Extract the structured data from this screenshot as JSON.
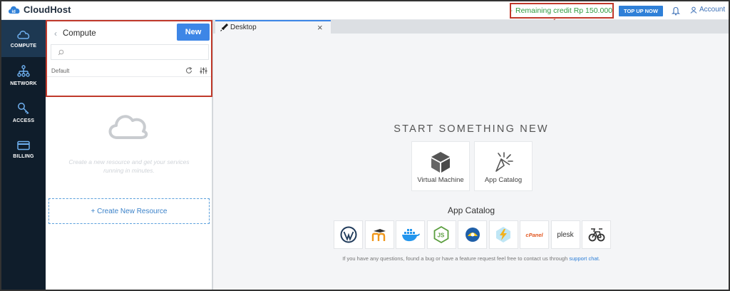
{
  "header": {
    "logo_badge": "id",
    "logo_text": "CloudHost",
    "credit_text": "Remaining credit Rp 150.000",
    "topup_label": "TOP UP NOW",
    "account_label": "Account",
    "credit_color": "#2e9b3e",
    "accent": "#2f80d8"
  },
  "sidebar": {
    "items": [
      {
        "label": "COMPUTE",
        "icon": "cloud-icon",
        "active": true
      },
      {
        "label": "NETWORK",
        "icon": "network-icon",
        "active": false
      },
      {
        "label": "ACCESS",
        "icon": "key-icon",
        "active": false
      },
      {
        "label": "BILLING",
        "icon": "card-icon",
        "active": false
      }
    ]
  },
  "compute_panel": {
    "title": "Compute",
    "new_label": "New",
    "search_placeholder": "",
    "group_label": "Default",
    "empty_message": "Create a new resource and get your services running in minutes.",
    "create_label": "+ Create New Resource"
  },
  "desktop": {
    "tab_label": "Desktop",
    "headline": "START SOMETHING NEW",
    "cards": [
      {
        "label": "Virtual Machine",
        "icon": "cube-icon"
      },
      {
        "label": "App Catalog",
        "icon": "cursor-click-icon"
      }
    ],
    "catalog_title": "App Catalog",
    "apps": [
      {
        "name": "wordpress-icon"
      },
      {
        "name": "moodle-icon"
      },
      {
        "name": "docker-icon"
      },
      {
        "name": "nodejs-icon"
      },
      {
        "name": "tutwuri-icon"
      },
      {
        "name": "lightning-app-icon"
      },
      {
        "name": "cpanel-icon",
        "text": "cPanel"
      },
      {
        "name": "plesk-icon",
        "text": "plesk"
      },
      {
        "name": "bike-app-icon"
      }
    ],
    "footer_text": "If you have any questions, found a bug or have a feature request feel free to contact us through",
    "footer_link": "support chat",
    "footer_end": "."
  }
}
